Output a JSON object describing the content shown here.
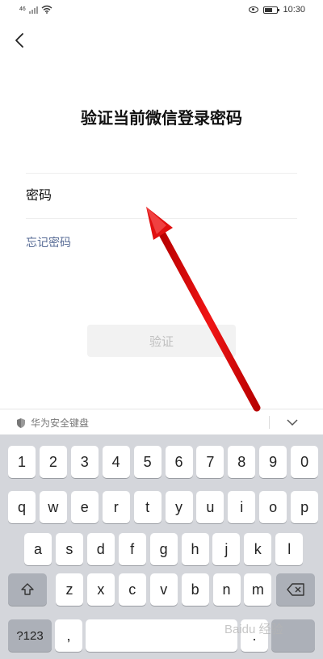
{
  "status_bar": {
    "signal_text": "46",
    "time": "10:30"
  },
  "page": {
    "title": "验证当前微信登录密码",
    "password_placeholder": "密码",
    "forgot_link": "忘记密码",
    "verify_button": "验证"
  },
  "keyboard": {
    "title": "华为安全键盘",
    "rows": [
      [
        "1",
        "2",
        "3",
        "4",
        "5",
        "6",
        "7",
        "8",
        "9",
        "0"
      ],
      [
        "q",
        "w",
        "e",
        "r",
        "t",
        "y",
        "u",
        "i",
        "o",
        "p"
      ],
      [
        "a",
        "s",
        "d",
        "f",
        "g",
        "h",
        "j",
        "k",
        "l"
      ],
      [
        "z",
        "x",
        "c",
        "v",
        "b",
        "n",
        "m"
      ]
    ],
    "symbols_key": "?123",
    "comma_key": ",",
    "period_key": "."
  },
  "watermark": "Baidu 经验",
  "colors": {
    "link": "#576b95",
    "arrow": "#e01010",
    "keyboard_bg": "#d4d6db",
    "button_disabled_bg": "#f2f2f2"
  },
  "icons": {
    "back": "chevron-left-icon",
    "shield": "shield-icon",
    "collapse": "chevron-down-icon",
    "shift": "shift-icon",
    "backspace": "backspace-icon",
    "wifi": "wifi-icon",
    "eye": "eye-icon",
    "battery": "battery-icon"
  }
}
